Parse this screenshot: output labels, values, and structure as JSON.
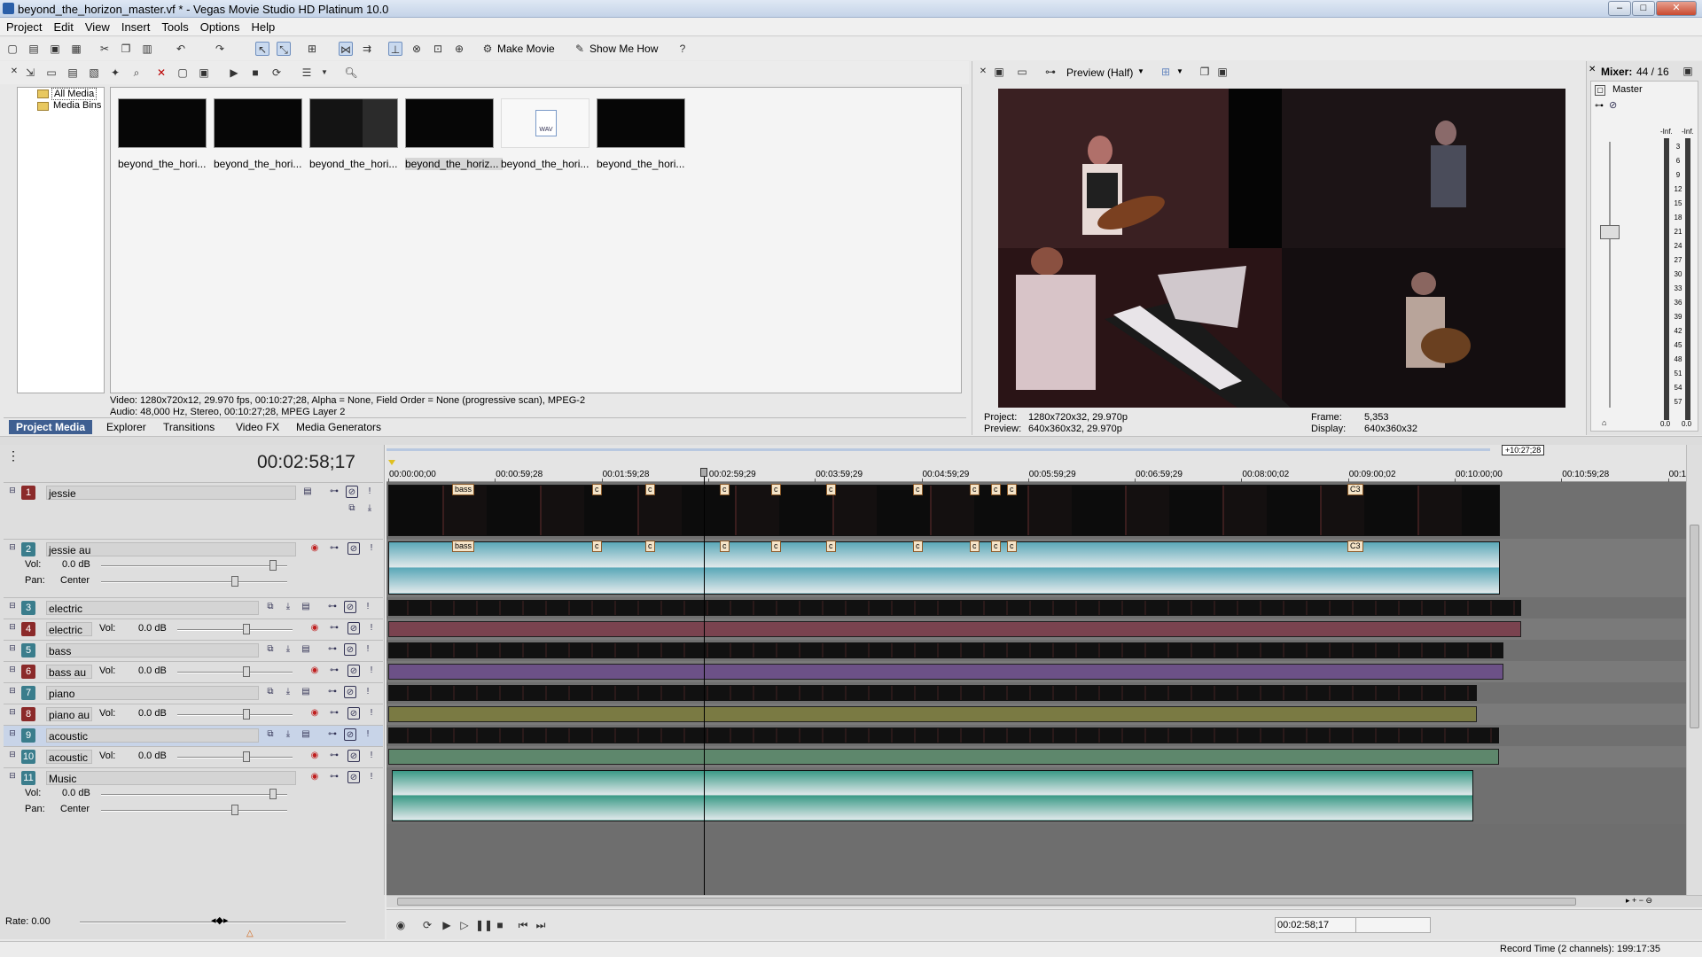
{
  "window": {
    "title": "beyond_the_horizon_master.vf * - Vegas Movie Studio HD Platinum 10.0"
  },
  "menu": [
    "Project",
    "Edit",
    "View",
    "Insert",
    "Tools",
    "Options",
    "Help"
  ],
  "toolbar": {
    "make_movie": "Make Movie",
    "show_me_how": "Show Me How"
  },
  "media_tree": {
    "items": [
      "All Media",
      "Media Bins"
    ]
  },
  "media": {
    "items": [
      {
        "label": "beyond_the_hori...",
        "kind": "video"
      },
      {
        "label": "beyond_the_hori...",
        "kind": "video"
      },
      {
        "label": "beyond_the_hori...",
        "kind": "video"
      },
      {
        "label": "beyond_the_horiz...",
        "kind": "video",
        "selected": true
      },
      {
        "label": "beyond_the_hori...",
        "kind": "wav"
      },
      {
        "label": "beyond_the_hori...",
        "kind": "video"
      }
    ],
    "wav_badge": "WAV",
    "info_video": "Video: 1280x720x12, 29.970 fps, 00:10:27;28, Alpha = None, Field Order = None (progressive scan), MPEG-2",
    "info_audio": "Audio: 48,000 Hz, Stereo, 00:10:27;28, MPEG Layer 2"
  },
  "tabs": [
    "Project Media",
    "Explorer",
    "Transitions",
    "Video FX",
    "Media Generators"
  ],
  "preview": {
    "mode": "Preview (Half)",
    "project_label": "Project:",
    "project_value": "1280x720x32, 29.970p",
    "preview_label": "Preview:",
    "preview_value": "640x360x32, 29.970p",
    "frame_label": "Frame:",
    "frame_value": "5,353",
    "display_label": "Display:",
    "display_value": "640x360x32"
  },
  "mixer": {
    "title": "Mixer:",
    "count": "44 / 16",
    "master": "Master",
    "peak_l": "-Inf.",
    "peak_r": "-Inf.",
    "scale": [
      "3",
      "6",
      "9",
      "12",
      "15",
      "18",
      "21",
      "24",
      "27",
      "30",
      "33",
      "36",
      "39",
      "42",
      "45",
      "48",
      "51",
      "54",
      "57"
    ],
    "val_l": "0.0",
    "val_r": "0.0"
  },
  "timeline": {
    "timecode": "00:02:58;17",
    "end_tag": "+10:27;28",
    "ruler": [
      "00:00:00;00",
      "00:00:59;28",
      "00:01:59;28",
      "00:02:59;29",
      "00:03:59;29",
      "00:04:59;29",
      "00:05:59;29",
      "00:06:59;29",
      "00:08:00;02",
      "00:09:00;02",
      "00:10:00;00",
      "00:10:59;28",
      "00:1"
    ],
    "markers": {
      "bass": "bass",
      "c3": "C3",
      "c": "c"
    },
    "tracks": [
      {
        "num": "1",
        "name": "jessie",
        "type": "video",
        "color": "#8b2a2a"
      },
      {
        "num": "2",
        "name": "jessie au",
        "type": "audio",
        "color": "#3a7d8c",
        "vol_label": "Vol:",
        "vol": "0.0 dB",
        "pan_label": "Pan:",
        "pan": "Center"
      },
      {
        "num": "3",
        "name": "electric",
        "type": "video",
        "color": "#3a7d8c"
      },
      {
        "num": "4",
        "name": "electric au",
        "type": "audio",
        "color": "#8b2a2a",
        "vol_label": "Vol:",
        "vol": "0.0 dB"
      },
      {
        "num": "5",
        "name": "bass",
        "type": "video",
        "color": "#3a7d8c"
      },
      {
        "num": "6",
        "name": "bass au",
        "type": "audio",
        "color": "#8b2a2a",
        "vol_label": "Vol:",
        "vol": "0.0 dB"
      },
      {
        "num": "7",
        "name": "piano",
        "type": "video",
        "color": "#3a7d8c"
      },
      {
        "num": "8",
        "name": "piano au",
        "type": "audio",
        "color": "#8b2a2a",
        "vol_label": "Vol:",
        "vol": "0.0 dB"
      },
      {
        "num": "9",
        "name": "acoustic",
        "type": "video",
        "color": "#3a7d8c"
      },
      {
        "num": "10",
        "name": "acoustic au",
        "type": "audio",
        "color": "#3a7d8c",
        "vol_label": "Vol:",
        "vol": "0.0 dB"
      },
      {
        "num": "11",
        "name": "Music",
        "type": "audio",
        "color": "#3a7d8c",
        "vol_label": "Vol:",
        "vol": "0.0 dB",
        "pan_label": "Pan:",
        "pan": "Center"
      }
    ]
  },
  "rate": "Rate: 0.00",
  "transport": {
    "timecode": "00:02:58;17"
  },
  "status": {
    "record_time": "Record Time (2 channels): 199:17:35"
  },
  "colors": {
    "title_bg": "#c4d3e8",
    "tab_active": "#3f5f91",
    "audio_teal": "#5aa8b8",
    "music_green": "#3a9a86",
    "electric_red": "#7a3a48",
    "bass_purple": "#6a4a8a",
    "piano_olive": "#7a7a3a",
    "acoustic_green": "#5a8a6a"
  }
}
